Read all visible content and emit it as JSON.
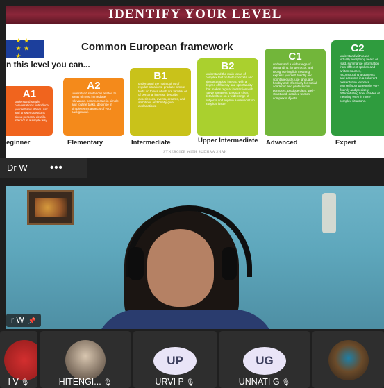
{
  "slide": {
    "banner": "IDENTIFY YOUR LEVEL",
    "eu_flag_stars": "★ ★ ★ ★ ★",
    "title": "Common European framework",
    "intro": "n this level you can...",
    "footer": "SYNERGIZE WITH SUDHAA SHAH",
    "levels": [
      {
        "code": "A1",
        "name": "eginner",
        "color": "#f0641e",
        "desc": "understand simple conversations. introduce yourself and others. ask and answer questions about personal details. interact in a simple way."
      },
      {
        "code": "A2",
        "name": "Elementary",
        "color": "#f48a1b",
        "desc": "understand sentences related to areas of most immediate relevance. communicate in simple and routine tasks. describe in simple terms aspects of your background."
      },
      {
        "code": "B1",
        "name": "Intermediate",
        "color": "#c9c21a",
        "desc": "understand the main points of regular situations. produce simple texts on topics which are familiar or of personal interest. describe experiences, events, dreams, and ambitions and briefly give explanations."
      },
      {
        "code": "B2",
        "name": "Upper Intermediate",
        "color": "#aad02e",
        "desc": "understand the main ideas of complex text on both concrete and abstract topics. interact with a degree of fluency and spontaneity that makes regular interaction with native speakers. produce clear, detailed text on a wide range of subjects and explain a viewpoint on a topical issue."
      },
      {
        "code": "C1",
        "name": "Advanced",
        "color": "#72b63a",
        "desc": "understand a wide range of demanding, longer texts, and recognise implicit meaning. express yourself fluently and spontaneously. use language flexibly and effectively for social, academic and professional purposes. produce clear, well-structured, detailed text on complex subjects."
      },
      {
        "code": "C2",
        "name": "Expert",
        "color": "#2f9c3e",
        "desc": "understand with ease virtually everything heard or read. summarise information from different spoken and written sources, reconstructing arguments and accounts in a coherent presentation. express yourself spontaneously, very fluently and precisely, differentiating finer shades of meaning even in more complex situations."
      }
    ]
  },
  "meeting": {
    "presenter_name": "Dr W",
    "more_icon": "•••",
    "speaker_name": "r W",
    "pin_icon": "📌",
    "participants": [
      {
        "label": "I V",
        "avatar": "photo",
        "color": "#c62828"
      },
      {
        "label": "HITENGI...",
        "avatar": "photo",
        "color": "#8a7a6a"
      },
      {
        "label": "URVI P",
        "avatar": "initials",
        "initials": "UP"
      },
      {
        "label": "UNNATI G",
        "avatar": "initials",
        "initials": "UG"
      },
      {
        "label": "",
        "avatar": "photo",
        "color": "#3a2c22"
      }
    ],
    "mic_off_icon": "🎙"
  }
}
